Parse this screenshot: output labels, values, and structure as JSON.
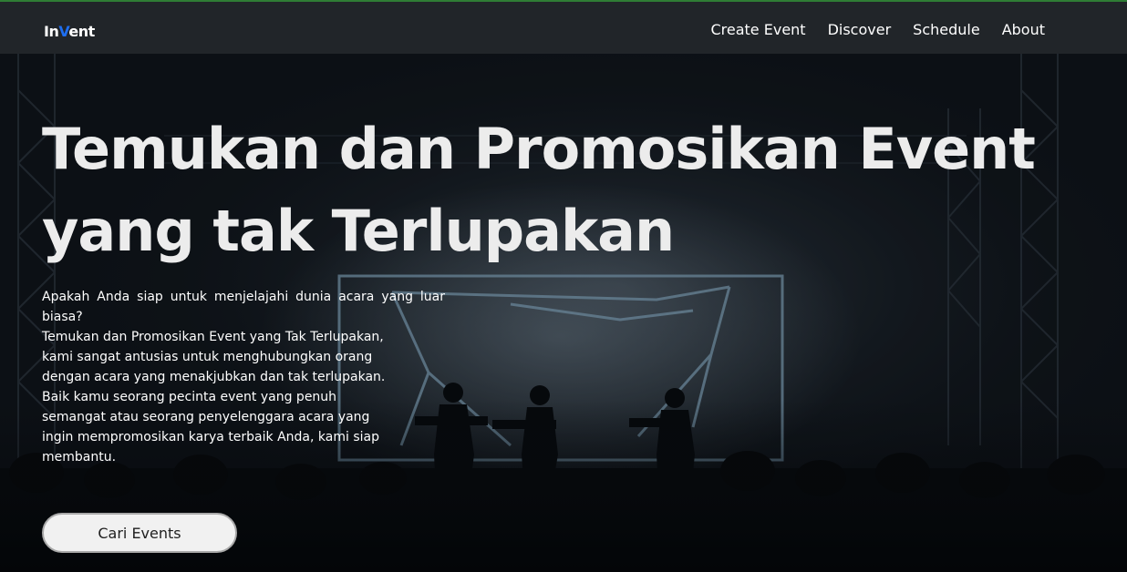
{
  "brand": {
    "prefix": "In",
    "accent": "V",
    "suffix": "ent",
    "accent_color": "#1e6ef0"
  },
  "nav": {
    "items": [
      {
        "label": "Create Event"
      },
      {
        "label": "Discover"
      },
      {
        "label": "Schedule"
      },
      {
        "label": "About"
      }
    ]
  },
  "hero": {
    "title_line1": "Temukan dan Promosikan Event",
    "title_line2": "yang tak Terlupakan",
    "intro": "Apakah Anda siap untuk menjelajahi dunia acara yang luar biasa?",
    "body": "Temukan dan Promosikan Event yang Tak Terlupakan, kami sangat antusias untuk menghubungkan orang dengan acara yang menakjubkan dan tak terlupakan. Baik kamu seorang pecinta event yang penuh semangat atau seorang penyelenggara acara yang ingin mempromosikan karya terbaik Anda, kami siap membantu.",
    "cta_label": "Cari Events"
  },
  "colors": {
    "navbar_bg": "#212529",
    "navbar_top_border": "#2f7d35",
    "hero_bg": "#0c1015",
    "cta_bg": "#f1f1f1"
  }
}
